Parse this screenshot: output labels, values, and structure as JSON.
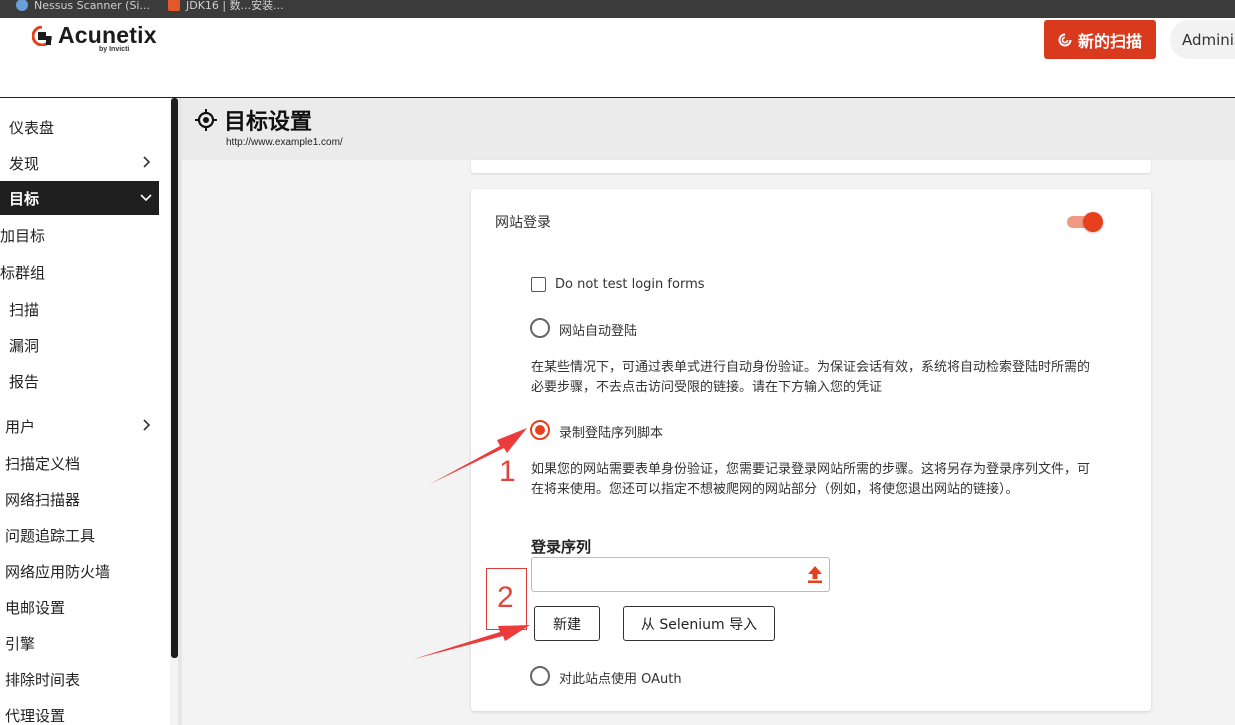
{
  "browser": {
    "tab1": "Nessus Scanner (Si...",
    "tab2": "JDK16 | 数...安装..."
  },
  "header": {
    "logo_text": "Acunetix",
    "logo_sub": "by Invicti",
    "new_scan_label": "新的扫描",
    "user_label": "Administrator"
  },
  "sidebar": {
    "items": [
      {
        "label": "仪表盘"
      },
      {
        "label": "发现"
      },
      {
        "label": "目标"
      },
      {
        "label": "加目标"
      },
      {
        "label": "标群组"
      },
      {
        "label": "扫描"
      },
      {
        "label": "漏洞"
      },
      {
        "label": "报告"
      },
      {
        "label": "用户"
      },
      {
        "label": "扫描定义档"
      },
      {
        "label": "网络扫描器"
      },
      {
        "label": "问题追踪工具"
      },
      {
        "label": "网络应用防火墙"
      },
      {
        "label": "电邮设置"
      },
      {
        "label": "引擎"
      },
      {
        "label": "排除时间表"
      },
      {
        "label": "代理设置"
      }
    ]
  },
  "page": {
    "title": "目标设置",
    "url": "http://www.example1.com/"
  },
  "login_section": {
    "title": "网站登录",
    "enabled": true,
    "checkbox_label": "Do not test login forms",
    "auto_login_label": "网站自动登陆",
    "auto_login_desc": "在某些情况下，可通过表单式进行自动身份验证。为保证会话有效，系统将自动检索登陆时所需的必要步骤，不去点击访问受限的链接。请在下方输入您的凭证",
    "record_label": "录制登陆序列脚本",
    "record_desc": "如果您的网站需要表单身份验证，您需要记录登录网站所需的步骤。这将另存为登录序列文件，可在将来使用。您还可以指定不想被爬网的网站部分（例如，将使您退出网站的链接）。",
    "sequence_field_label": "登录序列",
    "sequence_value": "",
    "new_button": "新建",
    "import_button": "从 Selenium 导入",
    "oauth_label": "对此站点使用 OAuth"
  },
  "annotations": {
    "marker1": "1",
    "marker2": "2"
  },
  "colors": {
    "accent": "#e8401f",
    "button_red": "#d9391d",
    "annotation": "#e0463f"
  }
}
